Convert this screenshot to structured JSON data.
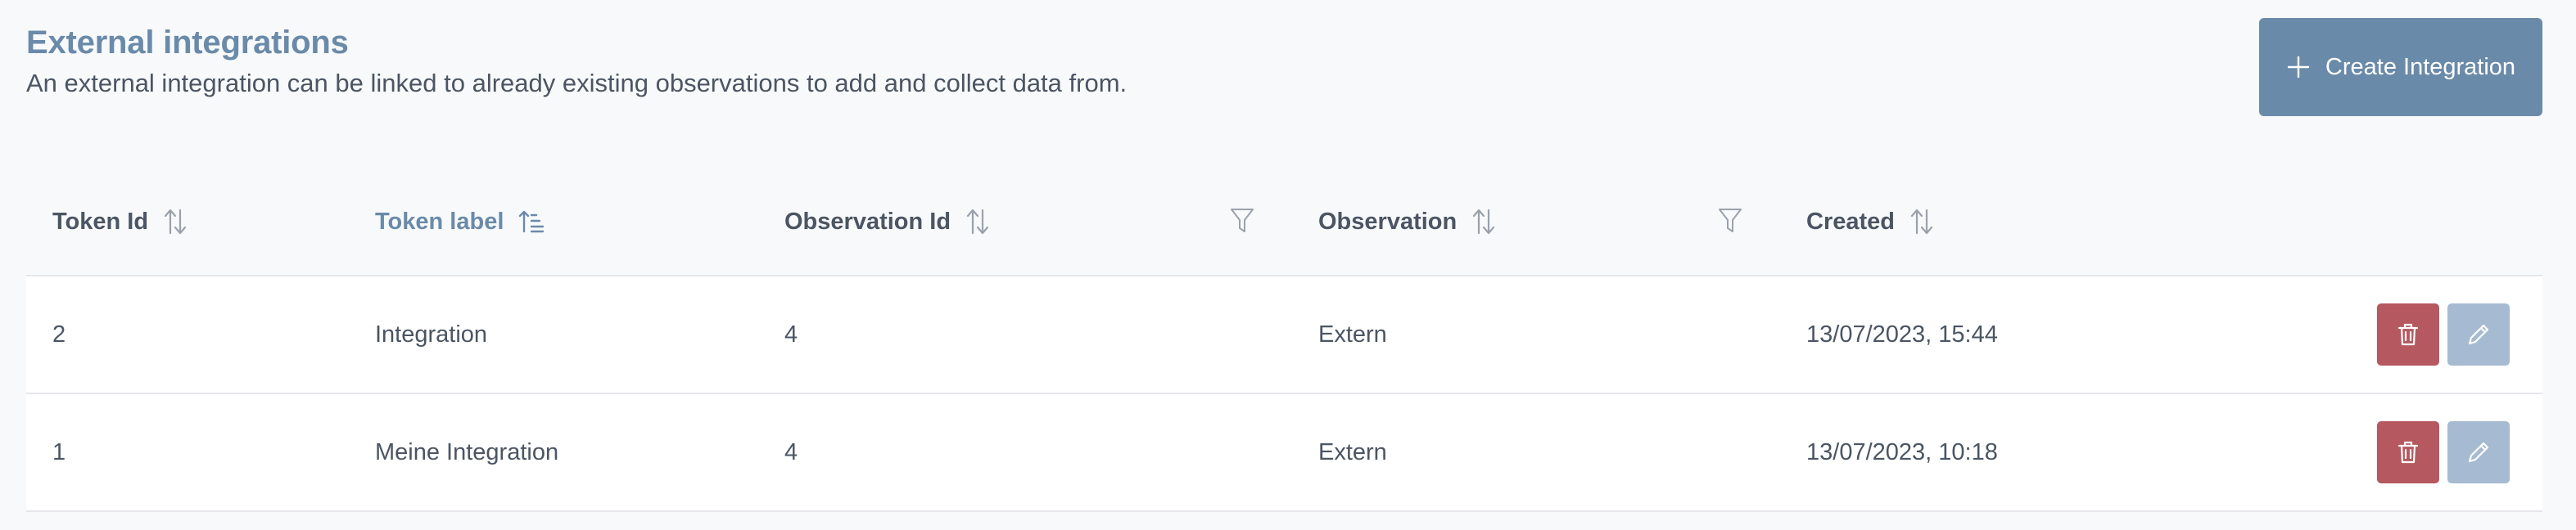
{
  "header": {
    "title": "External integrations",
    "subtitle": "An external integration can be linked to already existing observations to add and collect data from."
  },
  "toolbar": {
    "create_label": "Create Integration"
  },
  "table": {
    "columns": [
      {
        "label": "Token Id"
      },
      {
        "label": "Token label"
      },
      {
        "label": "Observation Id"
      },
      {
        "label": "Observation"
      },
      {
        "label": "Created"
      }
    ],
    "rows": [
      {
        "token_id": "2",
        "token_label": "Integration",
        "observation_id": "4",
        "observation": "Extern",
        "created": "13/07/2023, 15:44"
      },
      {
        "token_id": "1",
        "token_label": "Meine Integration",
        "observation_id": "4",
        "observation": "Extern",
        "created": "13/07/2023, 10:18"
      }
    ]
  },
  "colors": {
    "accent": "#6a8aa9",
    "delete": "#b5585f",
    "edit": "#a6bbd1"
  },
  "icons": [
    "plus-icon",
    "sort-icon",
    "sort-asc-icon",
    "filter-icon",
    "trash-icon",
    "pencil-icon"
  ]
}
